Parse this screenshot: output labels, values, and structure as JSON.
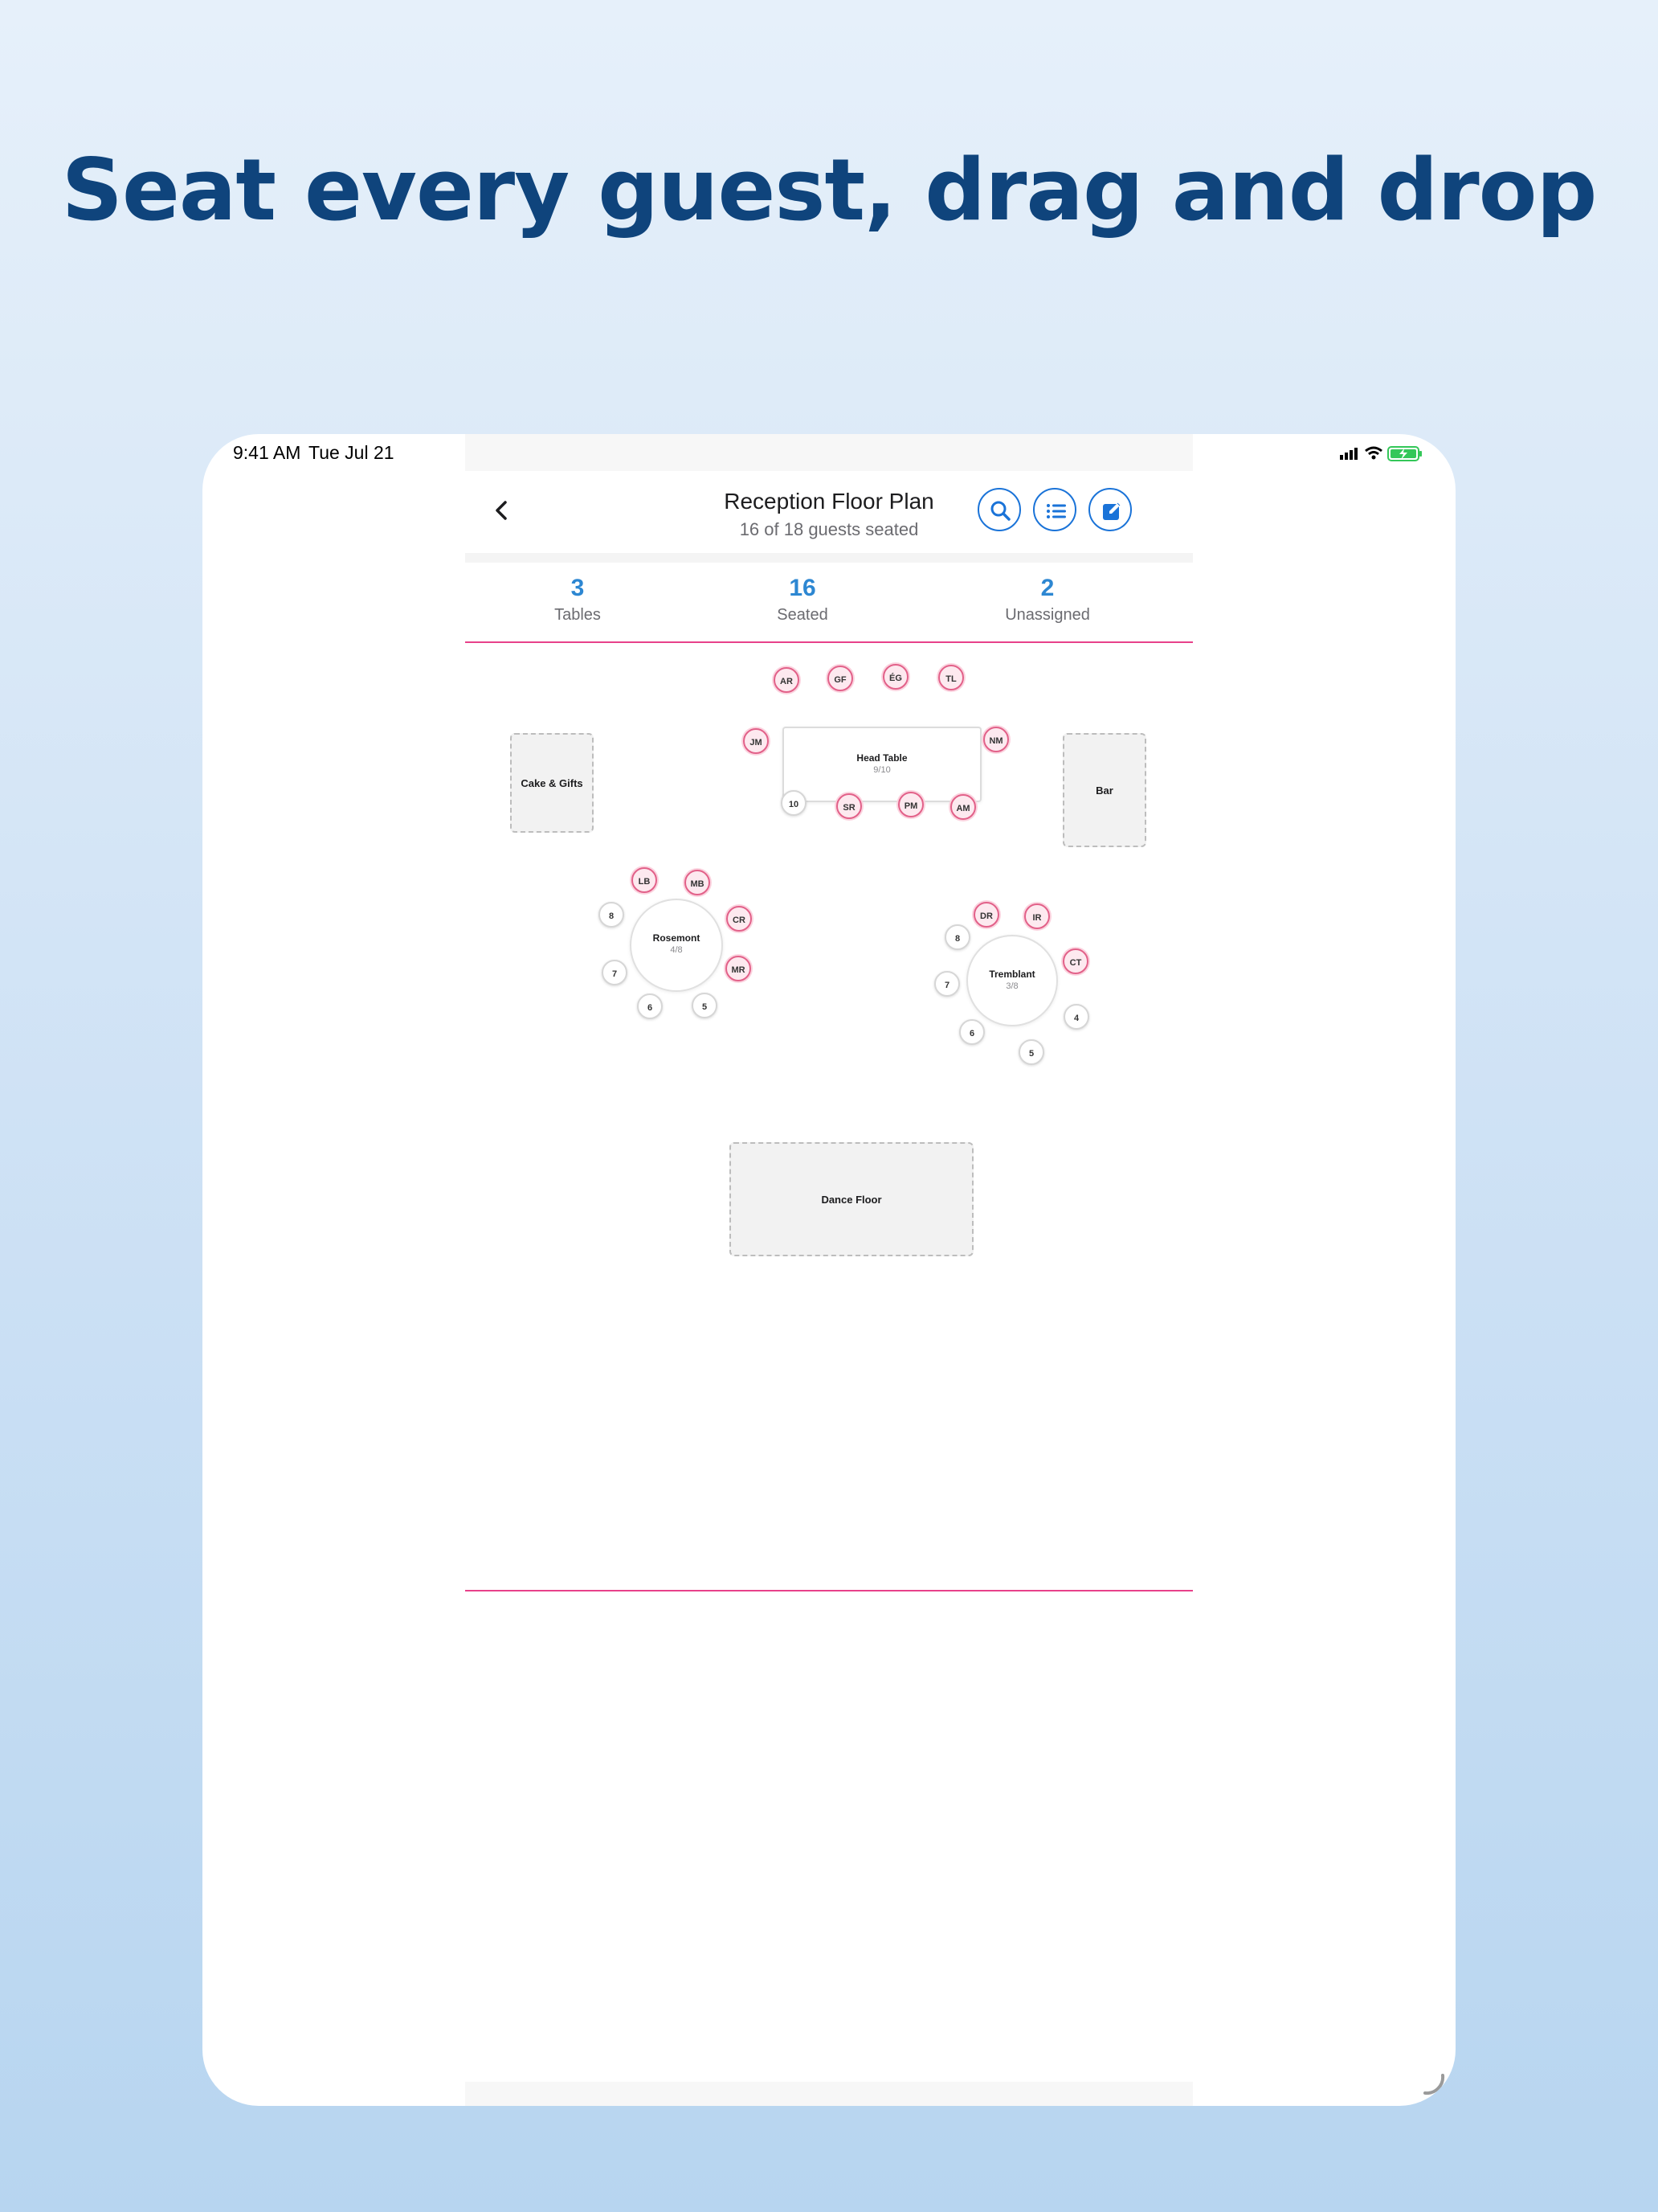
{
  "headline": "Seat every guest, drag and drop",
  "status_bar": {
    "time": "9:41 AM",
    "date": "Tue Jul 21"
  },
  "nav": {
    "title": "Reception Floor Plan",
    "subtitle": "16 of 18 guests seated"
  },
  "stats": [
    {
      "value": "3",
      "label": "Tables"
    },
    {
      "value": "16",
      "label": "Seated"
    },
    {
      "value": "2",
      "label": "Unassigned"
    }
  ],
  "zones": {
    "cake": "Cake & Gifts",
    "bar": "Bar",
    "dance": "Dance Floor"
  },
  "tables": {
    "head": {
      "name": "Head Table",
      "count": "9/10",
      "seats": [
        "AR",
        "GF",
        "ÉG",
        "TL",
        "JM",
        "NM",
        "10",
        "SR",
        "PM",
        "AM"
      ]
    },
    "rosemont": {
      "name": "Rosemont",
      "count": "4/8",
      "seats": [
        "LB",
        "MB",
        "CR",
        "MR",
        "5",
        "6",
        "7",
        "8"
      ]
    },
    "tremblant": {
      "name": "Tremblant",
      "count": "3/8",
      "seats": [
        "DR",
        "IR",
        "CT",
        "4",
        "5",
        "6",
        "7",
        "8"
      ]
    }
  },
  "colors": {
    "accent": "#1a73d8",
    "stat": "#2d87d2",
    "divider": "#e8418a",
    "headline": "#0f447c"
  }
}
